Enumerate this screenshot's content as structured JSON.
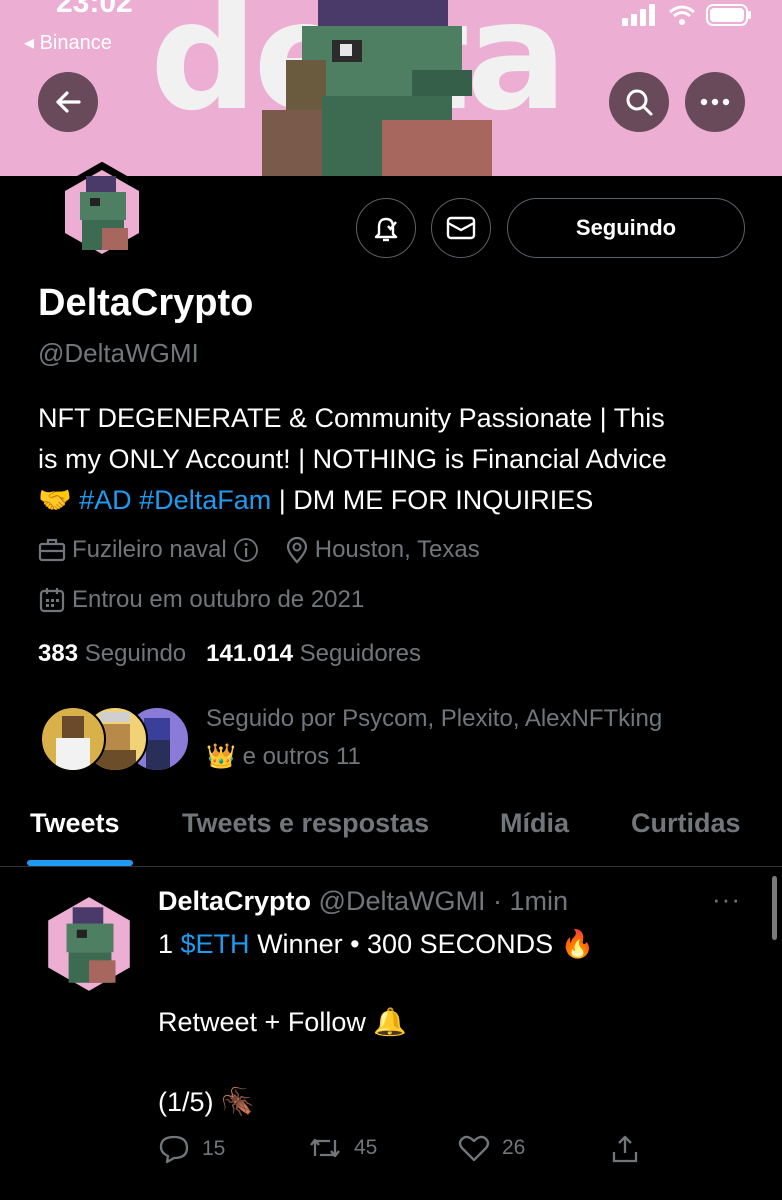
{
  "status_bar": {
    "time": "23:02",
    "back_app": "◂ Binance"
  },
  "banner": {
    "word": "delta"
  },
  "buttons": {
    "follow_label": "Seguindo"
  },
  "profile": {
    "name": "DeltaCrypto",
    "handle": "@DeltaWGMI",
    "bio_line1": "NFT DEGENERATE & Community Passionate | This",
    "bio_line2": "is my ONLY Account! | NOTHING is Financial Advice",
    "bio_emoji": "🤝",
    "bio_tags": "#AD #DeltaFam",
    "bio_rest": " | DM ME FOR INQUIRIES",
    "occupation": "Fuzileiro naval",
    "location": "Houston, Texas",
    "joined": "Entrou em outubro de 2021",
    "following_count": "383",
    "following_label": "Seguindo",
    "followers_count": "141.014",
    "followers_label": "Seguidores",
    "followed_by_line1": "Seguido por Psycom, Plexito, AlexNFTking",
    "followed_by_emoji": "👑",
    "followed_by_line2": "e outros 11"
  },
  "tabs": [
    {
      "label": "Tweets"
    },
    {
      "label": "Tweets e respostas"
    },
    {
      "label": "Mídia"
    },
    {
      "label": "Curtidas"
    }
  ],
  "tweet": {
    "name": "DeltaCrypto",
    "handle": "@DeltaWGMI",
    "time": "· 1min",
    "more": "···",
    "line1_pre": "1 ",
    "line1_link": "$ETH",
    "line1_post": " Winner • 300 SECONDS 🔥",
    "line2": "Retweet + Follow 🔔",
    "line3": "(1/5) 🪳",
    "replies": "15",
    "retweets": "45",
    "likes": "26"
  },
  "colors": {
    "accent": "#1d9bf0",
    "banner": "#ecaed2",
    "muted": "#71767b"
  }
}
